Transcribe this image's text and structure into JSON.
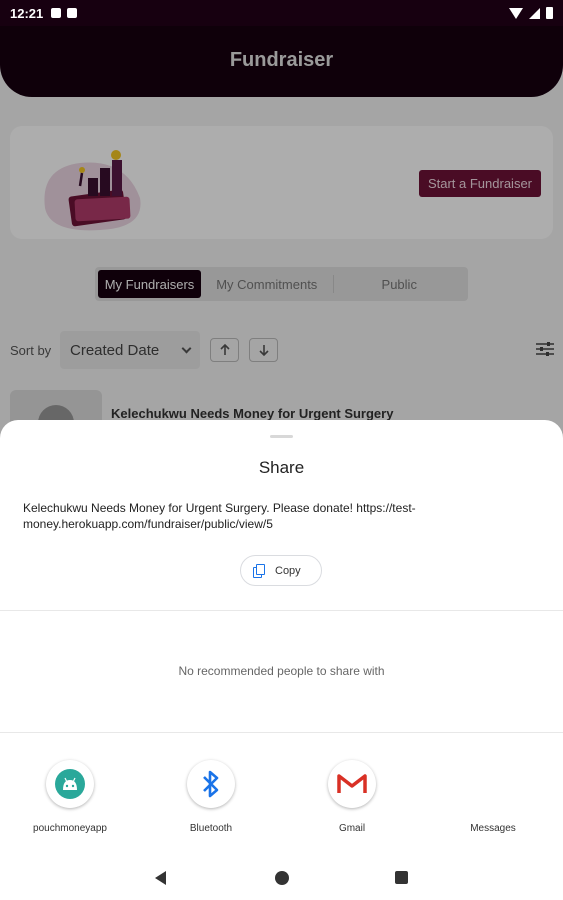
{
  "status_bar": {
    "time": "12:21"
  },
  "header": {
    "title": "Fundraiser"
  },
  "banner": {
    "start_button": "Start a Fundraiser"
  },
  "tabs": [
    {
      "label": "My Fundraisers",
      "active": true
    },
    {
      "label": "My Commitments",
      "active": false
    },
    {
      "label": "Public",
      "active": false
    }
  ],
  "sort": {
    "label": "Sort by",
    "selected": "Created Date"
  },
  "fundraiser_item": {
    "title": "Kelechukwu Needs Money for Urgent Surgery"
  },
  "share_sheet": {
    "title": "Share",
    "text": "Kelechukwu Needs Money for Urgent Surgery. Please donate!  https://test-money.herokuapp.com/fundraiser/public/view/5",
    "copy_label": "Copy",
    "no_people": "No recommended people to share with",
    "apps": [
      {
        "label": "pouchmoneyapp",
        "icon": "android-icon"
      },
      {
        "label": "Bluetooth",
        "icon": "bluetooth-icon"
      },
      {
        "label": "Gmail",
        "icon": "gmail-icon"
      },
      {
        "label": "Messages",
        "icon": "messages-icon"
      }
    ]
  },
  "colors": {
    "header_bg": "#170010",
    "accent": "#6e1237",
    "bluetooth": "#1a73e8",
    "android": "#2aa89a",
    "gmail": "#d93025"
  }
}
